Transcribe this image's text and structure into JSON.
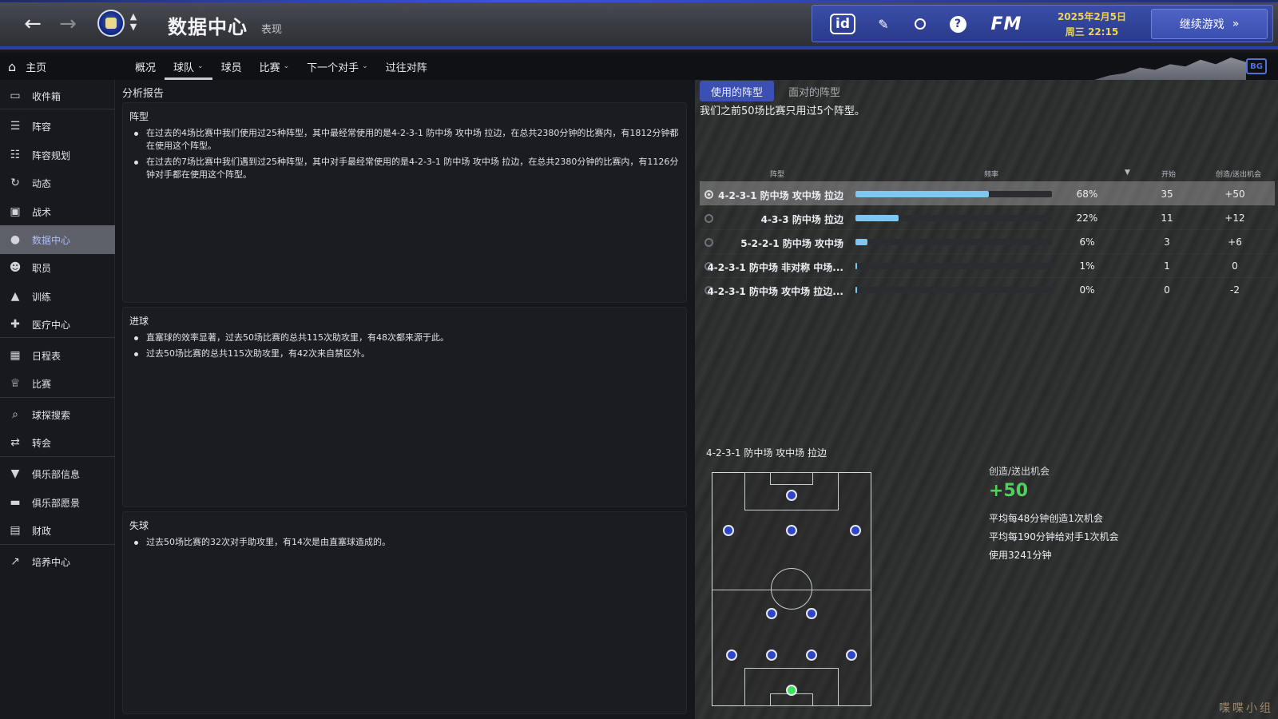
{
  "header": {
    "back_icon": "arrow-left-icon",
    "forward_icon": "arrow-right-icon",
    "title": "数据中心",
    "subtitle": "表现",
    "date": "2025年2月5日",
    "day_time": "周三 22:15",
    "fm_label": "FM",
    "id_label": "id",
    "continue_label": "继续游戏",
    "accent": "#3c4fb3",
    "date_color": "#f1d34f"
  },
  "subnav": {
    "home_label": "主页",
    "tabs": [
      {
        "label": "概况",
        "dropdown": false
      },
      {
        "label": "球队",
        "dropdown": true
      },
      {
        "label": "球员",
        "dropdown": false
      },
      {
        "label": "比赛",
        "dropdown": true
      },
      {
        "label": "下一个对手",
        "dropdown": true
      },
      {
        "label": "过往对阵",
        "dropdown": false
      }
    ],
    "active_tab": "球队"
  },
  "sidebar": {
    "items": [
      {
        "label": "收件箱",
        "icon": "inbox-icon"
      },
      {
        "label": "阵容",
        "icon": "shirt-icon"
      },
      {
        "label": "阵容规划",
        "icon": "clipboard-icon"
      },
      {
        "label": "动态",
        "icon": "dynamics-icon"
      },
      {
        "label": "战术",
        "icon": "tactics-icon"
      },
      {
        "label": "数据中心",
        "icon": "data-hub-icon"
      },
      {
        "label": "职员",
        "icon": "staff-icon"
      },
      {
        "label": "训练",
        "icon": "training-icon"
      },
      {
        "label": "医疗中心",
        "icon": "medical-icon"
      },
      {
        "label": "日程表",
        "icon": "calendar-icon"
      },
      {
        "label": "比赛",
        "icon": "trophy-icon"
      },
      {
        "label": "球探搜索",
        "icon": "search-icon"
      },
      {
        "label": "转会",
        "icon": "transfer-icon"
      },
      {
        "label": "俱乐部信息",
        "icon": "shield-icon"
      },
      {
        "label": "俱乐部愿景",
        "icon": "briefcase-icon"
      },
      {
        "label": "财政",
        "icon": "money-icon"
      },
      {
        "label": "培养中心",
        "icon": "growth-icon"
      }
    ],
    "active": "数据中心"
  },
  "analysis": {
    "section_title": "分析报告",
    "formation": {
      "title": "阵型",
      "bullets": [
        "在过去的4场比赛中我们使用过25种阵型，其中最经常使用的是4-2-3-1 防中场 攻中场 拉边，在总共2380分钟的比赛内，有1812分钟都在使用这个阵型。",
        "在过去的7场比赛中我们遇到过25种阵型，其中对手最经常使用的是4-2-3-1 防中场 攻中场 拉边，在总共2380分钟的比赛内，有1126分钟对手都在使用这个阵型。"
      ]
    },
    "attack": {
      "title": "进球",
      "bullets": [
        "直塞球的效率显著，过去50场比赛的总共115次助攻里，有48次都来源于此。",
        "过去50场比赛的总共115次助攻里，有42次来自禁区外。"
      ]
    },
    "defense": {
      "title": "失球",
      "bullets": [
        "过去50场比赛的32次对手助攻里，有14次是由直塞球造成的。"
      ]
    }
  },
  "formations": {
    "tabs": [
      "使用的阵型",
      "面对的阵型"
    ],
    "active_tab": "使用的阵型",
    "intro": "我们之前50场比赛只用过5个阵型。",
    "columns": {
      "name": "阵型",
      "freq": "频率",
      "starts": "开始",
      "chances": "创造/送出机会"
    },
    "rows": [
      {
        "name": "4-2-3-1 防中场 攻中场 拉边",
        "freq": 0.68,
        "freq_label": "68%",
        "starts": "35",
        "chances": "+50",
        "selected": true
      },
      {
        "name": "4-3-3 防中场 拉边",
        "freq": 0.22,
        "freq_label": "22%",
        "starts": "11",
        "chances": "+12",
        "selected": false
      },
      {
        "name": "5-2-2-1 防中场 攻中场",
        "freq": 0.06,
        "freq_label": "6%",
        "starts": "3",
        "chances": "+6",
        "selected": false
      },
      {
        "name": "4-2-3-1 防中场 非对称 中场...",
        "freq": 0.01,
        "freq_label": "1%",
        "starts": "1",
        "chances": "0",
        "selected": false
      },
      {
        "name": "4-2-3-1 防中场 攻中场 拉边...",
        "freq": 0.0,
        "freq_label": "0%",
        "starts": "0",
        "chances": "-2",
        "selected": false
      }
    ],
    "bar_color": "#7ec7f0"
  },
  "detail": {
    "pitch_title": "4-2-3-1 防中场 攻中场 拉边",
    "stat_label": "创造/送出机会",
    "stat_value": "+50",
    "stat_color": "#4fd15e",
    "lines": [
      "平均每48分钟创造1次机会",
      "平均每190分钟给对手1次机会",
      "使用3241分钟"
    ]
  },
  "watermark": "喋喋小组"
}
